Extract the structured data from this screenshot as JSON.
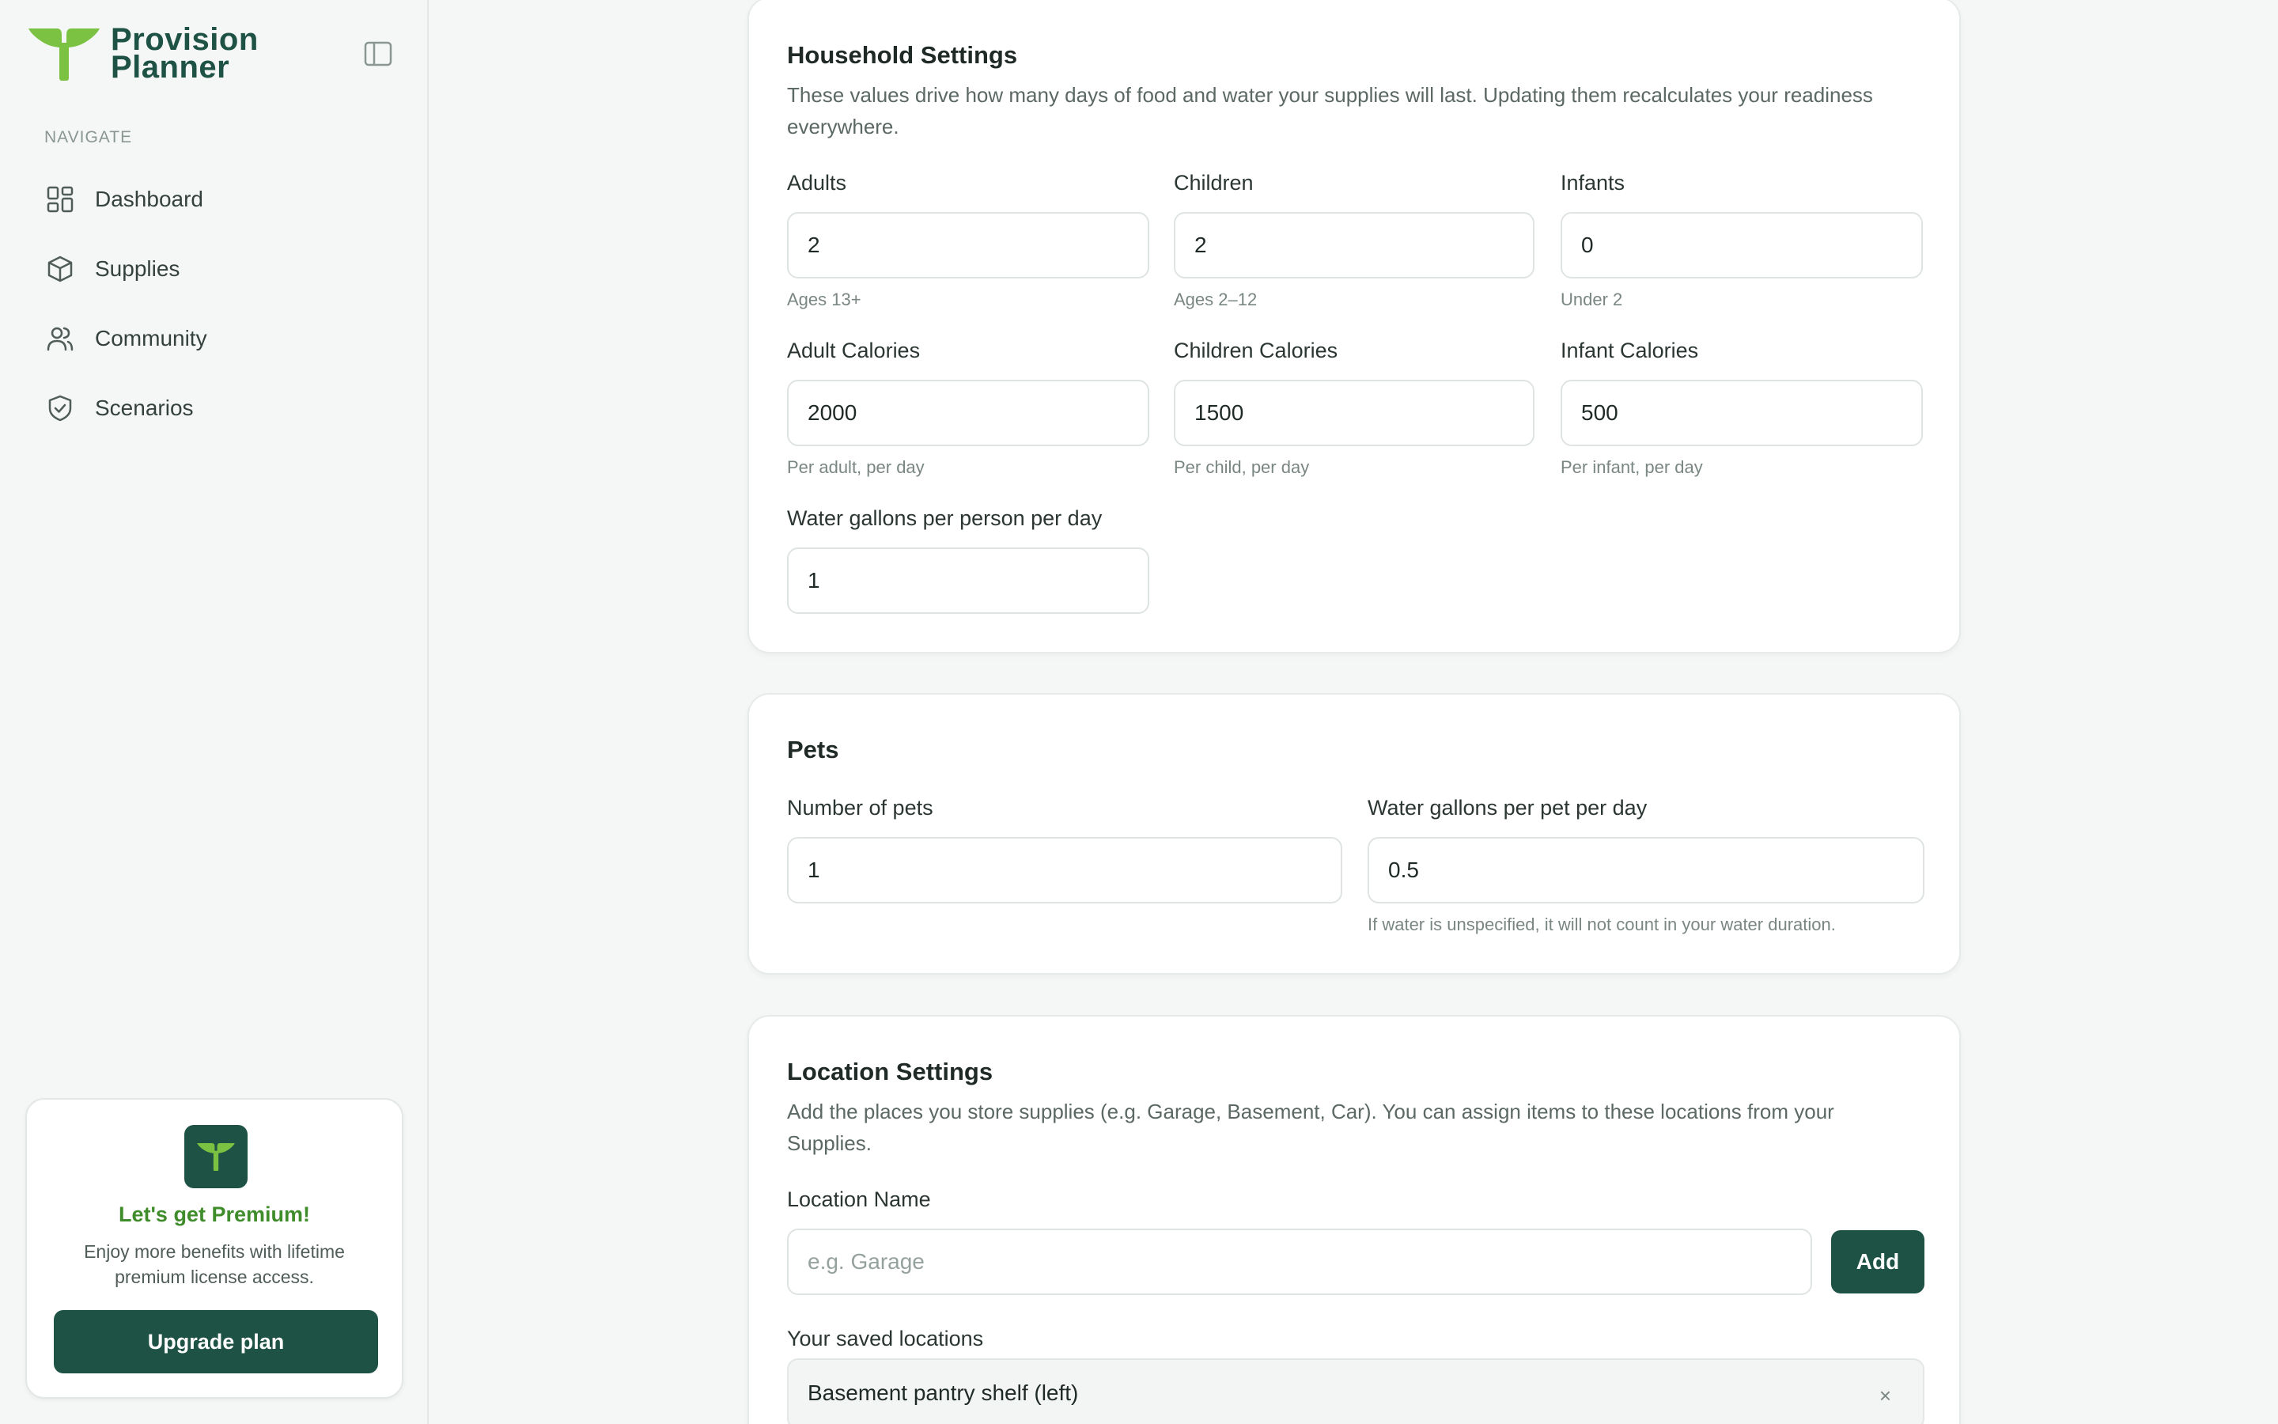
{
  "brand": {
    "line1": "Provision",
    "line2": "Planner"
  },
  "sidebar": {
    "nav_heading": "NAVIGATE",
    "items": [
      {
        "label": "Dashboard",
        "icon": "dashboard-icon"
      },
      {
        "label": "Supplies",
        "icon": "box-icon"
      },
      {
        "label": "Community",
        "icon": "users-icon"
      },
      {
        "label": "Scenarios",
        "icon": "shield-icon"
      }
    ]
  },
  "premium": {
    "title": "Let's get Premium!",
    "text": "Enjoy more benefits with lifetime premium license access.",
    "button": "Upgrade plan"
  },
  "household": {
    "title": "Household Settings",
    "description": "These values drive how many days of food and water your supplies will last. Updating them recalculates your readiness everywhere.",
    "adults": {
      "label": "Adults",
      "value": "2",
      "hint": "Ages 13+"
    },
    "children": {
      "label": "Children",
      "value": "2",
      "hint": "Ages 2–12"
    },
    "infants": {
      "label": "Infants",
      "value": "0",
      "hint": "Under 2"
    },
    "adult_calories": {
      "label": "Adult Calories",
      "value": "2000",
      "hint": "Per adult, per day"
    },
    "children_calories": {
      "label": "Children Calories",
      "value": "1500",
      "hint": "Per child, per day"
    },
    "infant_calories": {
      "label": "Infant Calories",
      "value": "500",
      "hint": "Per infant, per day"
    },
    "water": {
      "label": "Water gallons per person per day",
      "value": "1"
    }
  },
  "pets": {
    "title": "Pets",
    "count": {
      "label": "Number of pets",
      "value": "1"
    },
    "water": {
      "label": "Water gallons per pet per day",
      "value": "0.5",
      "hint": "If water is unspecified, it will not count in your water duration."
    }
  },
  "locations": {
    "title": "Location Settings",
    "description": "Add the places you store supplies (e.g. Garage, Basement, Car). You can assign items to these locations from your Supplies.",
    "name_label": "Location Name",
    "name_placeholder": "e.g. Garage",
    "add_button": "Add",
    "saved_heading": "Your saved locations",
    "saved": [
      {
        "label": "Basement pantry shelf (left)",
        "remove": "×"
      }
    ]
  },
  "colors": {
    "brand_dark": "#1d5244",
    "brand_light": "#7bc142",
    "premium_title": "#3f8c2a"
  }
}
